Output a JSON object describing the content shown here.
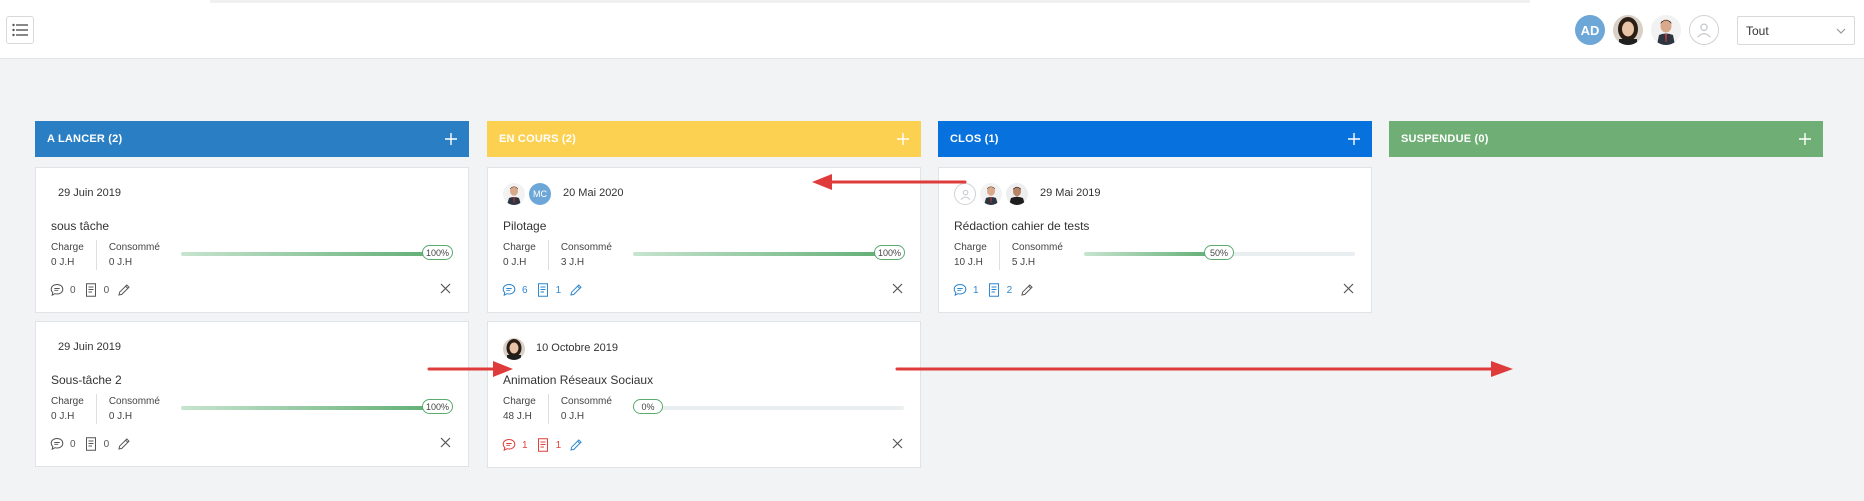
{
  "header": {
    "menu_icon": "list-icon",
    "avatars": [
      {
        "type": "initials",
        "text": "AD",
        "color": "#6da7d8"
      },
      {
        "type": "photo",
        "icon": "user-photo-woman"
      },
      {
        "type": "photo",
        "icon": "user-photo-man"
      },
      {
        "type": "empty",
        "icon": "user-placeholder-icon"
      }
    ],
    "filter_select": {
      "value": "Tout"
    }
  },
  "columns": [
    {
      "title": "A LANCER (2)",
      "color": "#2a7fc4"
    },
    {
      "title": "EN COURS (2)",
      "color": "#fcd050"
    },
    {
      "title": "CLOS (1)",
      "color": "#0771de"
    },
    {
      "title": "SUSPENDUE (0)",
      "color": "#6fae74"
    }
  ],
  "labels": {
    "charge": "Charge",
    "consomme": "Consommé"
  },
  "cards": {
    "a1": {
      "date": "29 Juin 2019",
      "title": "sous tâche",
      "charge": "0 J.H",
      "consomme": "0 J.H",
      "progress": 1.0,
      "progress_label": "100%",
      "comments": "0",
      "docs": "0"
    },
    "a2": {
      "date": "29 Juin 2019",
      "title": "Sous-tâche 2",
      "charge": "0 J.H",
      "consomme": "0 J.H",
      "progress": 1.0,
      "progress_label": "100%",
      "comments": "0",
      "docs": "0"
    },
    "b1": {
      "date": "20 Mai 2020",
      "title": "Pilotage",
      "charge": "0 J.H",
      "consomme": "3 J.H",
      "progress": 1.0,
      "progress_label": "100%",
      "comments": "6",
      "docs": "1",
      "assignee_initials": "MC"
    },
    "b2": {
      "date": "10 Octobre 2019",
      "title": "Animation Réseaux Sociaux",
      "charge": "48 J.H",
      "consomme": "0 J.H",
      "progress": 0.0,
      "progress_label": "0%",
      "comments": "1",
      "docs": "1"
    },
    "c1": {
      "date": "29 Mai 2019",
      "title": "Rédaction cahier de tests",
      "charge": "10 J.H",
      "consomme": "5 J.H",
      "progress": 0.5,
      "progress_label": "50%",
      "comments": "1",
      "docs": "2"
    }
  }
}
